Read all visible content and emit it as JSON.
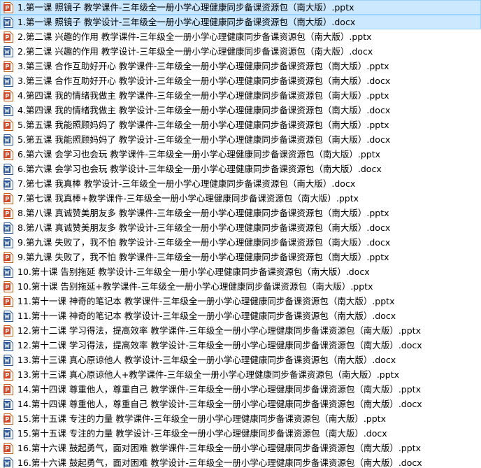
{
  "colors": {
    "selection_bg": "#cce8ff",
    "selection_border": "#99d1ff",
    "pptx_icon": "#d24726",
    "docx_icon": "#2b579a"
  },
  "files": [
    {
      "name": "1.第一课  照镜子 教学课件-三年级全一册小学心理健康同步备课资源包（南大版）.pptx",
      "type": "pptx",
      "icon": "powerpoint-icon",
      "selected": true
    },
    {
      "name": "1.第一课  照镜子 教学设计-三年级全一册小学心理健康同步备课资源包（南大版）.docx",
      "type": "docx",
      "icon": "word-icon",
      "selected": true
    },
    {
      "name": "2.第二课  兴趣的作用 教学课件-三年级全一册小学心理健康同步备课资源包（南大版）.pptx",
      "type": "pptx",
      "icon": "powerpoint-icon",
      "selected": false
    },
    {
      "name": "2.第二课  兴趣的作用 教学设计-三年级全一册小学心理健康同步备课资源包（南大版）.docx",
      "type": "docx",
      "icon": "word-icon",
      "selected": false
    },
    {
      "name": "3.第三课  合作互助好开心 教学课件-三年级全一册小学心理健康同步备课资源包（南大版）.pptx",
      "type": "pptx",
      "icon": "powerpoint-icon",
      "selected": false
    },
    {
      "name": "3.第三课  合作互助好开心 教学设计-三年级全一册小学心理健康同步备课资源包（南大版）.docx",
      "type": "docx",
      "icon": "word-icon",
      "selected": false
    },
    {
      "name": "4.第四课  我的情绪我做主 教学课件-三年级全一册小学心理健康同步备课资源包（南大版）.pptx",
      "type": "pptx",
      "icon": "powerpoint-icon",
      "selected": false
    },
    {
      "name": "4.第四课  我的情绪我做主 教学设计-三年级全一册小学心理健康同步备课资源包（南大版）.docx",
      "type": "docx",
      "icon": "word-icon",
      "selected": false
    },
    {
      "name": "5.第五课  我能照顾妈妈了 教学课件-三年级全一册小学心理健康同步备课资源包（南大版）.pptx",
      "type": "pptx",
      "icon": "powerpoint-icon",
      "selected": false
    },
    {
      "name": "5.第五课  我能照顾妈妈了 教学设计-三年级全一册小学心理健康同步备课资源包（南大版）.docx",
      "type": "docx",
      "icon": "word-icon",
      "selected": false
    },
    {
      "name": "6.第六课  会学习也会玩 教学课件-三年级全一册小学心理健康同步备课资源包（南大版）.pptx",
      "type": "pptx",
      "icon": "powerpoint-icon",
      "selected": false
    },
    {
      "name": "6.第六课  会学习也会玩 教学设计-三年级全一册小学心理健康同步备课资源包（南大版）.docx",
      "type": "docx",
      "icon": "word-icon",
      "selected": false
    },
    {
      "name": "7.第七课  我真棒  教学设计-三年级全一册小学心理健康同步备课资源包（南大版）.docx",
      "type": "docx",
      "icon": "word-icon",
      "selected": false
    },
    {
      "name": "7.第七课  我真棒+教学课件-三年级全一册小学心理健康同步备课资源包（南大版）.pptx",
      "type": "pptx",
      "icon": "powerpoint-icon",
      "selected": false
    },
    {
      "name": "8.第八课  真诚赞美朋友多 教学课件-三年级全一册小学心理健康同步备课资源包（南大版）.pptx",
      "type": "pptx",
      "icon": "powerpoint-icon",
      "selected": false
    },
    {
      "name": "8.第八课  真诚赞美朋友多 教学设计-三年级全一册小学心理健康同步备课资源包（南大版）.docx",
      "type": "docx",
      "icon": "word-icon",
      "selected": false
    },
    {
      "name": "9.第九课  失败了，我不怕  教学设计-三年级全一册小学心理健康同步备课资源包（南大版）.docx",
      "type": "docx",
      "icon": "word-icon",
      "selected": false
    },
    {
      "name": "9.第九课  失败了，我不怕 教学课件-三年级全一册小学心理健康同步备课资源包（南大版）.pptx",
      "type": "pptx",
      "icon": "powerpoint-icon",
      "selected": false
    },
    {
      "name": "10.第十课  告别拖延 教学设计-三年级全一册小学心理健康同步备课资源包（南大版）.docx",
      "type": "docx",
      "icon": "word-icon",
      "selected": false
    },
    {
      "name": "10.第十课  告别拖延+教学课件-三年级全一册小学心理健康同步备课资源包（南大版）.pptx",
      "type": "pptx",
      "icon": "powerpoint-icon",
      "selected": false
    },
    {
      "name": "11.第十一课  神奇的笔记本 教学课件-三年级全一册小学心理健康同步备课资源包（南大版）.pptx",
      "type": "pptx",
      "icon": "powerpoint-icon",
      "selected": false
    },
    {
      "name": "11.第十一课  神奇的笔记本 教学设计-三年级全一册小学心理健康同步备课资源包（南大版）.docx",
      "type": "docx",
      "icon": "word-icon",
      "selected": false
    },
    {
      "name": "12.第十二课  学习得法，提高效率 教学课件-三年级全一册小学心理健康同步备课资源包（南大版）.pptx",
      "type": "pptx",
      "icon": "powerpoint-icon",
      "selected": false
    },
    {
      "name": "12.第十二课  学习得法，提高效率 教学设计-三年级全一册小学心理健康同步备课资源包（南大版）.docx",
      "type": "docx",
      "icon": "word-icon",
      "selected": false
    },
    {
      "name": "13.第十三课  真心原谅他人 教学设计-三年级全一册小学心理健康同步备课资源包（南大版）.docx",
      "type": "docx",
      "icon": "word-icon",
      "selected": false
    },
    {
      "name": "13.第十三课  真心原谅他人+教学课件-三年级全一册小学心理健康同步备课资源包（南大版）.pptx",
      "type": "pptx",
      "icon": "powerpoint-icon",
      "selected": false
    },
    {
      "name": "14.第十四课  尊重他人，尊重自己 教学课件-三年级全一册小学心理健康同步备课资源包（南大版）.pptx",
      "type": "pptx",
      "icon": "powerpoint-icon",
      "selected": false
    },
    {
      "name": "14.第十四课  尊重他人，尊重自己 教学设计-三年级全一册小学心理健康同步备课资源包（南大版）.docx",
      "type": "docx",
      "icon": "word-icon",
      "selected": false
    },
    {
      "name": "15.第十五课  专注的力量 教学课件-三年级全一册小学心理健康同步备课资源包（南大版）.pptx",
      "type": "pptx",
      "icon": "powerpoint-icon",
      "selected": false
    },
    {
      "name": "15.第十五课  专注的力量 教学设计-三年级全一册小学心理健康同步备课资源包（南大版）.docx",
      "type": "docx",
      "icon": "word-icon",
      "selected": false
    },
    {
      "name": "16.第十六课  鼓起勇气，面对困难 教学课件-三年级全一册小学心理健康同步备课资源包（南大版）.pptx",
      "type": "pptx",
      "icon": "powerpoint-icon",
      "selected": false
    },
    {
      "name": "16.第十六课  鼓起勇气，面对困难 教学设计-三年级全一册小学心理健康同步备课资源包（南大版）.docx",
      "type": "docx",
      "icon": "word-icon",
      "selected": false
    }
  ]
}
